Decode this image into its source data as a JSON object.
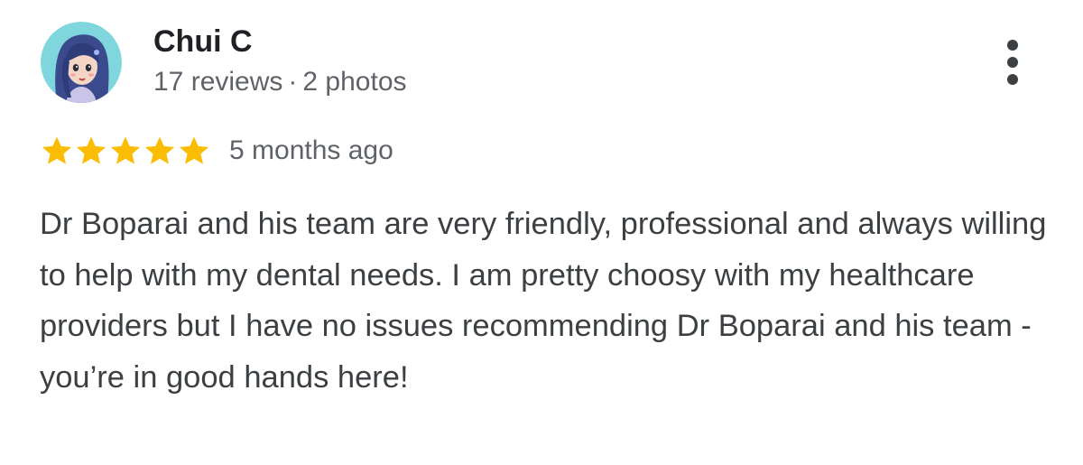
{
  "reviewer": {
    "name": "Chui C",
    "reviews_count": "17 reviews",
    "separator": "·",
    "photos_count": "2 photos",
    "avatar_icon": "cartoon-avatar-icon"
  },
  "more_menu_icon": "more-vert-icon",
  "rating": {
    "stars": 5,
    "max_stars": 5,
    "star_color": "#fbbc04",
    "time_ago": "5 months ago"
  },
  "review_text": "Dr Boparai and his team are very friendly, professional and always willing to help with my dental needs. I am pretty choosy with my healthcare providers but I have no issues recommending Dr Boparai and his team - you’re in good hands here!"
}
